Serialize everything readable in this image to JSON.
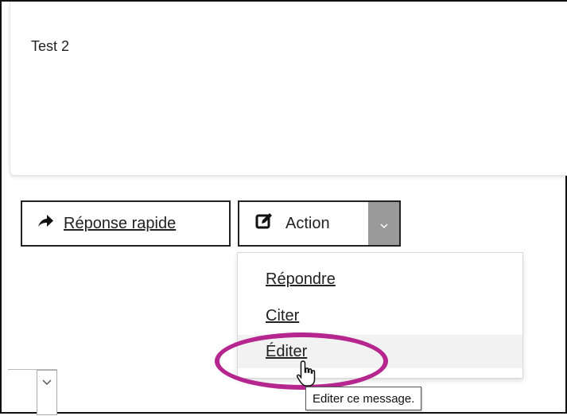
{
  "post": {
    "text": "Test 2"
  },
  "buttons": {
    "quick_reply": {
      "label": "Réponse rapide",
      "icon": "arrow-right-icon"
    },
    "action": {
      "label": "Action",
      "icon": "edit-icon",
      "caret_icon": "chevron-down-icon"
    }
  },
  "menu": {
    "items": [
      {
        "label": "Répondre"
      },
      {
        "label": "Citer"
      },
      {
        "label": "Éditer"
      }
    ]
  },
  "tooltip": {
    "text": "Editer ce message."
  },
  "annotation": {
    "color": "#b5278f"
  }
}
